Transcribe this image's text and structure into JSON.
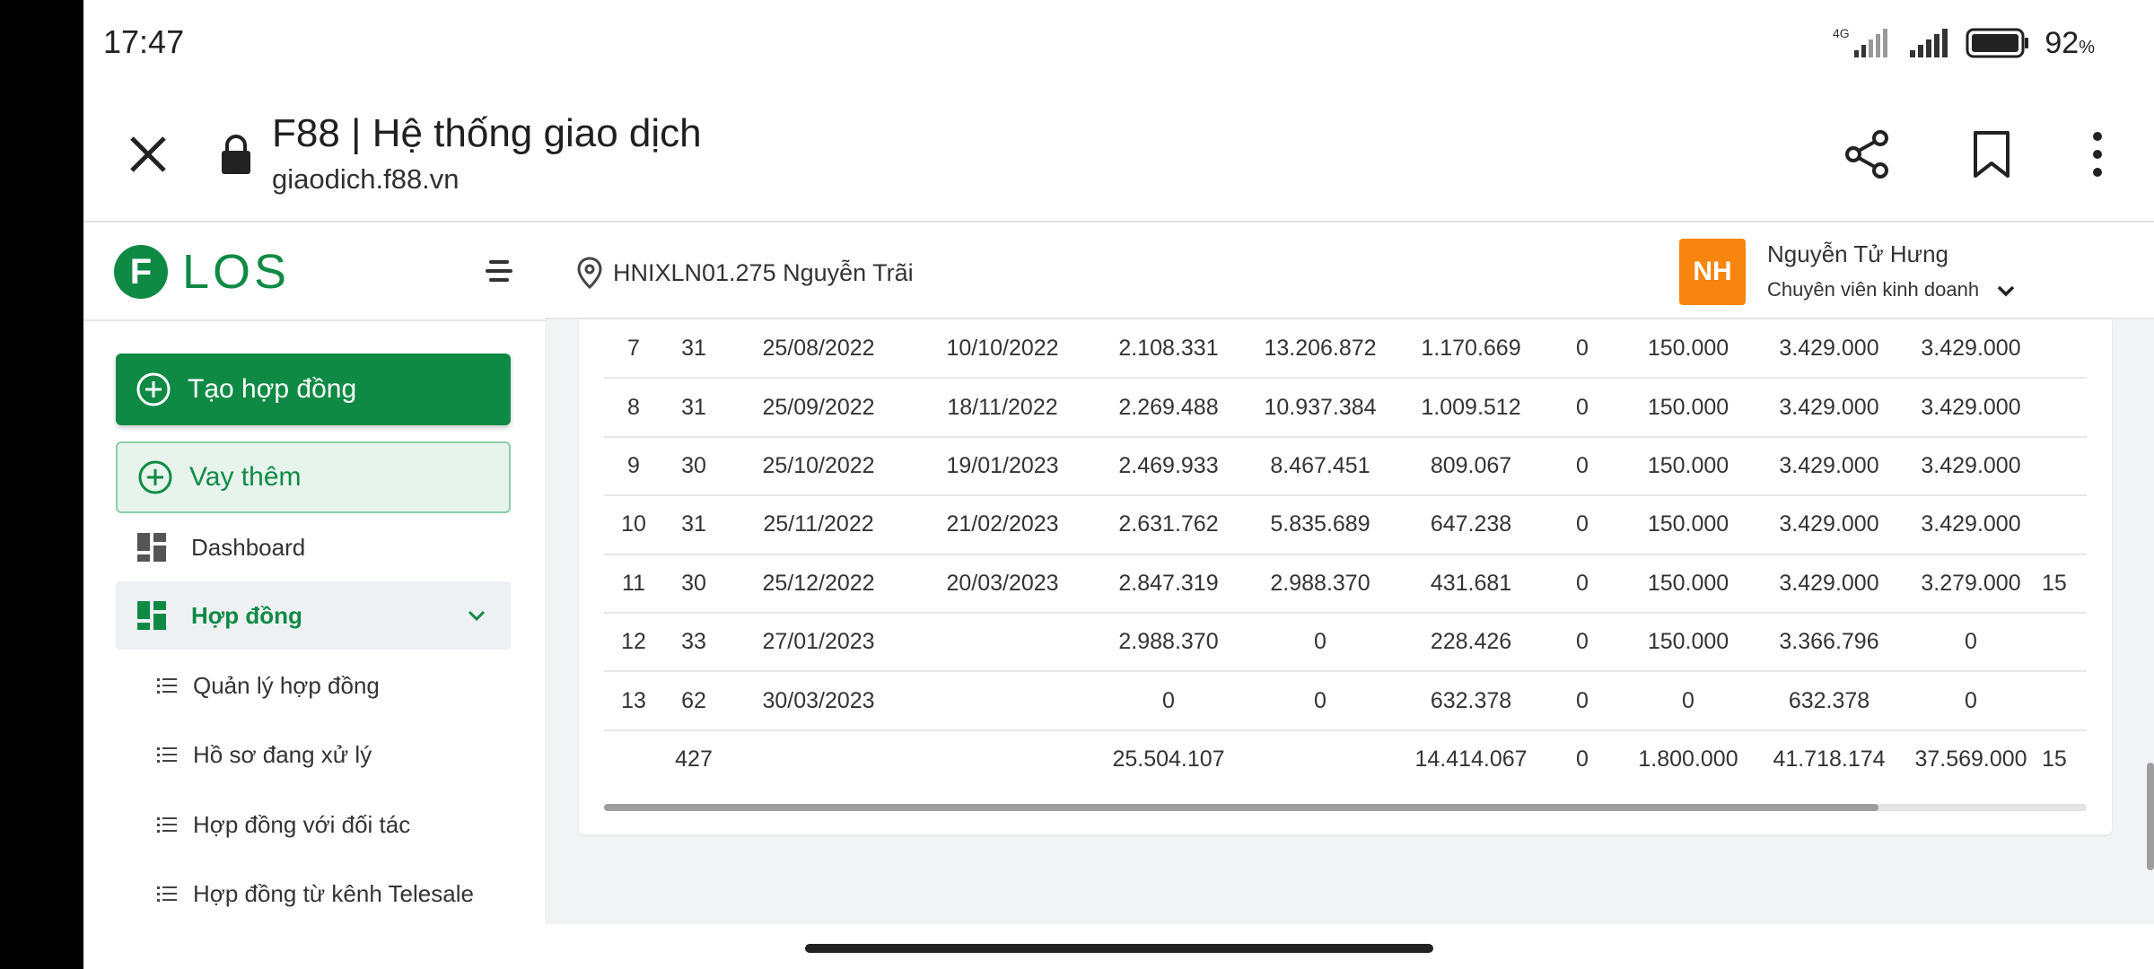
{
  "status": {
    "time": "17:47",
    "network": "4G",
    "battery": "92",
    "battery_unit": "%"
  },
  "browser": {
    "title": "F88 | Hệ thống giao dịch",
    "url": "giaodich.f88.vn"
  },
  "sidebar": {
    "logo_letter": "F",
    "logo_text": "LOS",
    "create_contract": "Tạo hợp đồng",
    "borrow_more": "Vay thêm",
    "dashboard": "Dashboard",
    "contracts": "Hợp đồng",
    "sub": [
      "Quản lý hợp đồng",
      "Hồ sơ đang xử lý",
      "Hợp đồng với đối tác",
      "Hợp đồng từ kênh Telesale"
    ]
  },
  "header": {
    "branch": "HNIXLN01.275 Nguyễn Trãi",
    "avatar_initials": "NH",
    "user_name": "Nguyễn Tử Hưng",
    "user_role": "Chuyên viên kinh doanh"
  },
  "table": {
    "rows": [
      [
        "7",
        "31",
        "25/08/2022",
        "10/10/2022",
        "2.108.331",
        "13.206.872",
        "1.170.669",
        "0",
        "150.000",
        "3.429.000",
        "3.429.000",
        ""
      ],
      [
        "8",
        "31",
        "25/09/2022",
        "18/11/2022",
        "2.269.488",
        "10.937.384",
        "1.009.512",
        "0",
        "150.000",
        "3.429.000",
        "3.429.000",
        ""
      ],
      [
        "9",
        "30",
        "25/10/2022",
        "19/01/2023",
        "2.469.933",
        "8.467.451",
        "809.067",
        "0",
        "150.000",
        "3.429.000",
        "3.429.000",
        ""
      ],
      [
        "10",
        "31",
        "25/11/2022",
        "21/02/2023",
        "2.631.762",
        "5.835.689",
        "647.238",
        "0",
        "150.000",
        "3.429.000",
        "3.429.000",
        ""
      ],
      [
        "11",
        "30",
        "25/12/2022",
        "20/03/2023",
        "2.847.319",
        "2.988.370",
        "431.681",
        "0",
        "150.000",
        "3.429.000",
        "3.279.000",
        "15"
      ],
      [
        "12",
        "33",
        "27/01/2023",
        "",
        "2.988.370",
        "0",
        "228.426",
        "0",
        "150.000",
        "3.366.796",
        "0",
        ""
      ],
      [
        "13",
        "62",
        "30/03/2023",
        "",
        "0",
        "0",
        "632.378",
        "0",
        "0",
        "632.378",
        "0",
        ""
      ],
      [
        "",
        "427",
        "",
        "",
        "25.504.107",
        "",
        "14.414.067",
        "0",
        "1.800.000",
        "41.718.174",
        "37.569.000",
        "15"
      ]
    ]
  },
  "colors": {
    "brand": "#0f8a45",
    "avatar": "#f7850f"
  }
}
